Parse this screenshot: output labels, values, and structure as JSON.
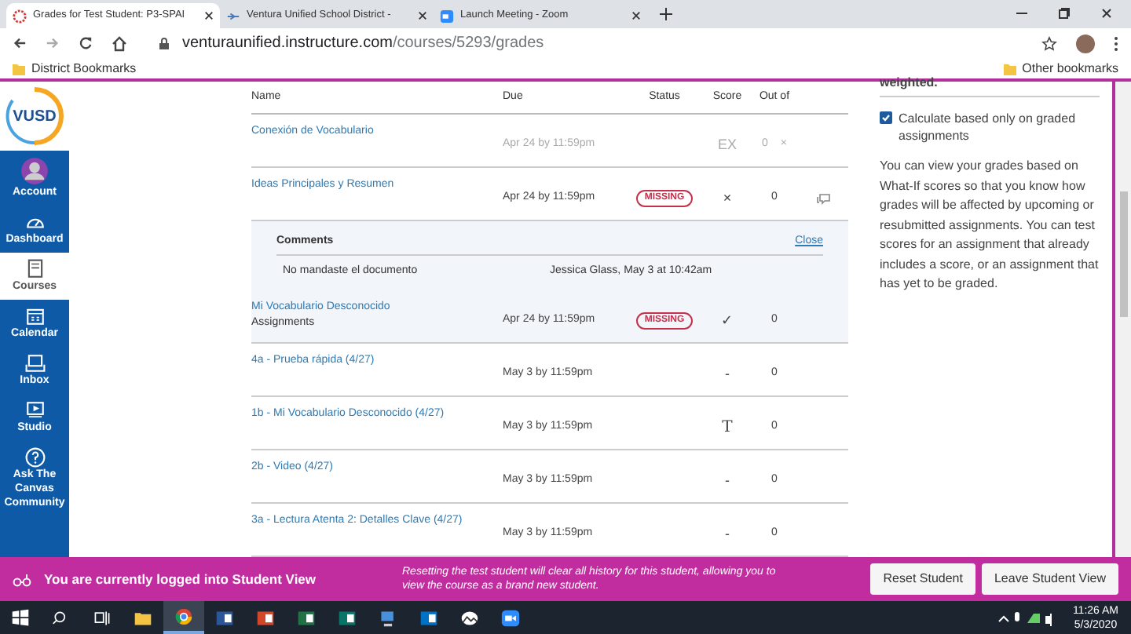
{
  "browser": {
    "tabs": [
      {
        "title": "Grades for Test Student: P3-SPAI",
        "selected": true,
        "kind": "canvas"
      },
      {
        "title": "Ventura Unified School District -",
        "selected": false,
        "kind": "district"
      },
      {
        "title": "Launch Meeting - Zoom",
        "selected": false,
        "kind": "zoom"
      }
    ],
    "url_host": "venturaunified.instructure.com",
    "url_path": "/courses/5293/grades",
    "bookmarks": [
      "District Bookmarks"
    ],
    "other_bookmarks": "Other bookmarks"
  },
  "logo": "VUSD",
  "nav": [
    {
      "label": "Account",
      "kind": "account",
      "selected": false
    },
    {
      "label": "Dashboard",
      "kind": "dashboard",
      "selected": false
    },
    {
      "label": "Courses",
      "kind": "courses",
      "selected": true
    },
    {
      "label": "Calendar",
      "kind": "calendar",
      "selected": false
    },
    {
      "label": "Inbox",
      "kind": "inbox",
      "selected": false
    },
    {
      "label": "Studio",
      "kind": "studio",
      "selected": false
    },
    {
      "label": "Ask The Canvas Community",
      "kind": "help",
      "selected": false
    }
  ],
  "table": {
    "columns": [
      "Name",
      "Due",
      "Status",
      "Score",
      "Out of"
    ],
    "rows": [
      {
        "name": "Conexión de Vocabulario",
        "due": "Apr 24 by 11:59pm",
        "score": "EX",
        "out_of": "0",
        "muted": true,
        "highlighted": false,
        "mark": "×"
      },
      {
        "name": "Ideas Principales y Resumen",
        "due": "Apr 24 by 11:59pm",
        "status": "MISSING",
        "score": "×",
        "out_of": "0",
        "muted": false,
        "highlighted": false,
        "has_comments": true,
        "comments": {
          "heading": "Comments",
          "close": "Close",
          "items": [
            {
              "text": "No mandaste el documento",
              "author": "Jessica Glass, May 3 at 10:42am"
            }
          ]
        }
      },
      {
        "name": "Mi Vocabulario Desconocido",
        "subtitle": "Assignments",
        "due": "Apr 24 by 11:59pm",
        "status": "MISSING",
        "score": "✓",
        "out_of": "0",
        "muted": false,
        "highlighted": true
      },
      {
        "name": "4a - Prueba rápida (4/27)",
        "due": "May 3 by 11:59pm",
        "score": "-",
        "out_of": "0",
        "muted": false,
        "highlighted": false
      },
      {
        "name": "1b - Mi Vocabulario Desconocido (4/27)",
        "due": "May 3 by 11:59pm",
        "score": "T",
        "out_of": "0",
        "muted": false,
        "highlighted": false
      },
      {
        "name": "2b - Video (4/27)",
        "due": "May 3 by 11:59pm",
        "score": "-",
        "out_of": "0",
        "muted": false,
        "highlighted": false
      },
      {
        "name": "3a - Lectura Atenta 2: Detalles Clave (4/27)",
        "due": "May 3 by 11:59pm",
        "score": "-",
        "out_of": "0",
        "muted": false,
        "highlighted": false
      }
    ]
  },
  "sidebar": {
    "heading": "weighted.",
    "checkbox": {
      "label": "Calculate based only on graded assignments",
      "checked": true
    },
    "text": "You can view your grades based on What-If scores so that you know how grades will be affected by upcoming or resubmitted assignments. You can test scores for an assignment that already includes a score, or an assignment that has yet to be graded."
  },
  "student_view": {
    "message": "You are currently logged into Student View",
    "note": "Resetting the test student will clear all history for this student, allowing you to view the course as a brand new student.",
    "buttons": [
      "Reset Student",
      "Leave Student View"
    ]
  },
  "taskbar": {
    "apps": [
      {
        "kind": "start",
        "active": false
      },
      {
        "kind": "search",
        "active": false
      },
      {
        "kind": "taskview",
        "active": false
      },
      {
        "kind": "explorer",
        "active": false
      },
      {
        "kind": "chrome",
        "active": true
      },
      {
        "kind": "word",
        "active": false
      },
      {
        "kind": "powerpoint",
        "active": false
      },
      {
        "kind": "excel",
        "active": false
      },
      {
        "kind": "publisher",
        "active": false
      },
      {
        "kind": "network",
        "active": false
      },
      {
        "kind": "outlook",
        "active": false
      },
      {
        "kind": "photos",
        "active": false
      },
      {
        "kind": "zoom",
        "active": false
      }
    ],
    "time": "11:26 AM",
    "date": "5/3/2020"
  }
}
